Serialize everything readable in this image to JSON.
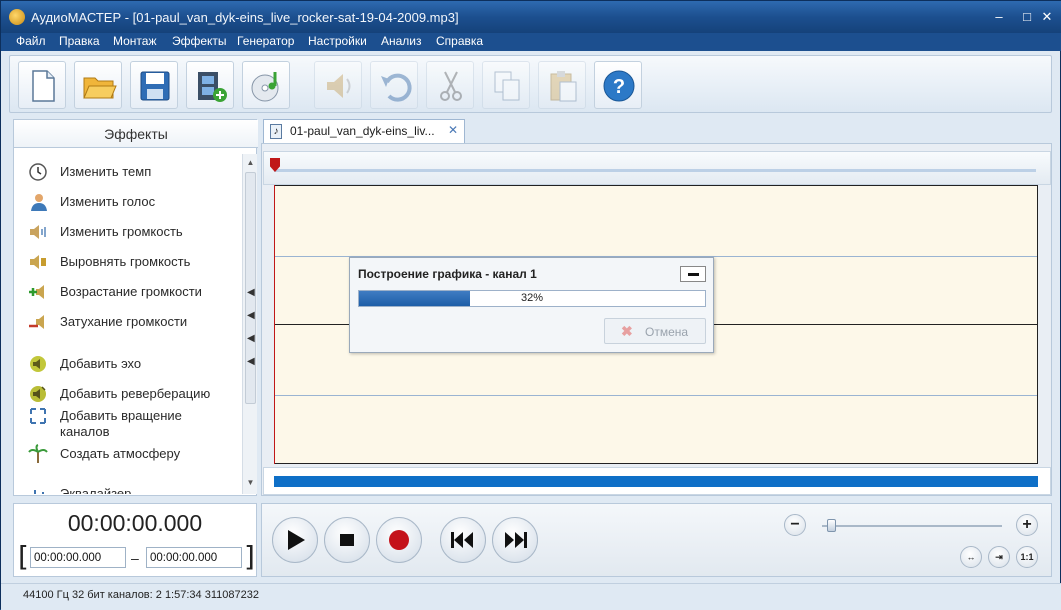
{
  "window": {
    "title": "АудиоМАСТЕР - [01-paul_van_dyk-eins_live_rocker-sat-19-04-2009.mp3]",
    "controls": {
      "minimize": "–",
      "maximize": "□",
      "close": "✕"
    }
  },
  "menu": [
    "Файл",
    "Правка",
    "Монтаж",
    "Эффекты",
    "Генератор",
    "Настройки",
    "Анализ",
    "Справка"
  ],
  "toolbar": {
    "buttons": [
      {
        "icon": "new-file-icon",
        "enabled": true
      },
      {
        "icon": "open-folder-icon",
        "enabled": true
      },
      {
        "icon": "save-icon",
        "enabled": true
      },
      {
        "icon": "add-video-icon",
        "enabled": true
      },
      {
        "icon": "cd-music-icon",
        "enabled": true
      },
      {
        "icon": "speaker-icon",
        "enabled": false
      },
      {
        "icon": "undo-icon",
        "enabled": false
      },
      {
        "icon": "cut-icon",
        "enabled": false
      },
      {
        "icon": "copy-icon",
        "enabled": false
      },
      {
        "icon": "paste-icon",
        "enabled": false
      },
      {
        "icon": "help-icon",
        "enabled": true
      }
    ]
  },
  "effects_panel": {
    "title": "Эффекты",
    "items": [
      {
        "label": "Изменить темп",
        "icon": "clock-icon"
      },
      {
        "label": "Изменить голос",
        "icon": "person-icon"
      },
      {
        "label": "Изменить громкость",
        "icon": "volume-icon"
      },
      {
        "label": "Выровнять громкость",
        "icon": "equalize-volume-icon"
      },
      {
        "label": "Возрастание громкости",
        "icon": "fade-in-icon"
      },
      {
        "label": "Затухание громкости",
        "icon": "fade-out-icon"
      },
      {
        "label": "Добавить эхо",
        "icon": "echo-icon"
      },
      {
        "label": "Добавить реверберацию",
        "icon": "reverb-icon"
      },
      {
        "label": "Добавить вращение каналов",
        "icon": "rotate-channels-icon"
      },
      {
        "label": "Создать атмосферу",
        "icon": "atmosphere-icon"
      },
      {
        "label": "Эквалайзер",
        "icon": "equalizer-icon"
      }
    ]
  },
  "document_tab": {
    "label": "01-paul_van_dyk-eins_liv...",
    "close": "✕"
  },
  "progress_dialog": {
    "title": "Построение графика - канал 1",
    "progress": 0.32,
    "progress_text": "32%",
    "cancel_label": "Отмена"
  },
  "time": {
    "current": "00:00:00.000",
    "selection_start": "00:00:00.000",
    "selection_end": "00:00:00.000",
    "bracket_left": "[",
    "bracket_right": "]",
    "separator": "–"
  },
  "zoom": {
    "minus": "−",
    "plus": "+",
    "level": 0.05,
    "fit_label": "↔",
    "one_to_one_label": "1:1"
  },
  "status": "44100 Гц  32 бит  каналов: 2   1:57:34 311087232"
}
